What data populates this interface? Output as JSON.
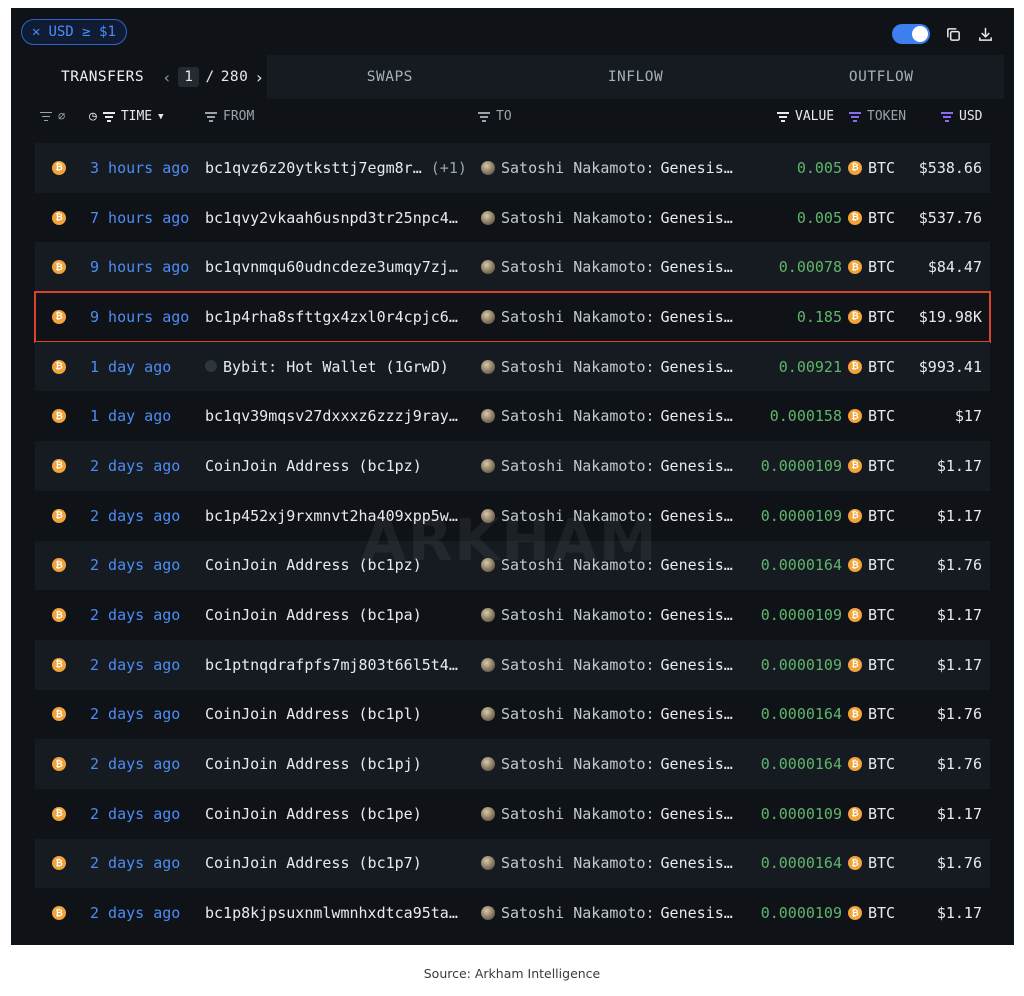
{
  "filter_chip": {
    "label": "USD ≥ $1"
  },
  "tabs": [
    {
      "label": "TRANSFERS"
    },
    {
      "label": "SWAPS"
    },
    {
      "label": "INFLOW"
    },
    {
      "label": "OUTFLOW"
    }
  ],
  "pagination": {
    "current": "1",
    "separator": "/",
    "total": "280"
  },
  "columns": {
    "time": "TIME",
    "from": "FROM",
    "to": "TO",
    "value": "VALUE",
    "token": "TOKEN",
    "usd": "USD"
  },
  "rows": [
    {
      "time": "3 hours ago",
      "from": "bc1qvz6z20ytksttj7egm8r…",
      "from_extra": "(+1)",
      "to_name": "Satoshi Nakamoto:",
      "to_detail": "Genesis…",
      "value": "0.005",
      "token": "BTC",
      "usd": "$538.66"
    },
    {
      "time": "7 hours ago",
      "from": "bc1qvy2vkaah6usnpd3tr25npc4…",
      "from_extra": "",
      "to_name": "Satoshi Nakamoto:",
      "to_detail": "Genesis…",
      "value": "0.005",
      "token": "BTC",
      "usd": "$537.76"
    },
    {
      "time": "9 hours ago",
      "from": "bc1qvnmqu60udncdeze3umqy7zj…",
      "from_extra": "",
      "to_name": "Satoshi Nakamoto:",
      "to_detail": "Genesis…",
      "value": "0.00078",
      "token": "BTC",
      "usd": "$84.47"
    },
    {
      "time": "9 hours ago",
      "from": "bc1p4rha8sfttgx4zxl0r4cpjc6…",
      "from_extra": "",
      "to_name": "Satoshi Nakamoto:",
      "to_detail": "Genesis…",
      "value": "0.185",
      "token": "BTC",
      "usd": "$19.98K"
    },
    {
      "time": "1 day ago",
      "from": "Bybit: Hot Wallet (1GrwD)",
      "from_extra": "",
      "to_name": "Satoshi Nakamoto:",
      "to_detail": "Genesis…",
      "value": "0.00921",
      "token": "BTC",
      "usd": "$993.41"
    },
    {
      "time": "1 day ago",
      "from": "bc1qv39mqsv27dxxxz6zzzj9ray…",
      "from_extra": "",
      "to_name": "Satoshi Nakamoto:",
      "to_detail": "Genesis…",
      "value": "0.000158",
      "token": "BTC",
      "usd": "$17"
    },
    {
      "time": "2 days ago",
      "from": "CoinJoin Address (bc1pz)",
      "from_extra": "",
      "to_name": "Satoshi Nakamoto:",
      "to_detail": "Genesis…",
      "value": "0.0000109",
      "token": "BTC",
      "usd": "$1.17"
    },
    {
      "time": "2 days ago",
      "from": "bc1p452xj9rxmnvt2ha409xpp5w…",
      "from_extra": "",
      "to_name": "Satoshi Nakamoto:",
      "to_detail": "Genesis…",
      "value": "0.0000109",
      "token": "BTC",
      "usd": "$1.17"
    },
    {
      "time": "2 days ago",
      "from": "CoinJoin Address (bc1pz)",
      "from_extra": "",
      "to_name": "Satoshi Nakamoto:",
      "to_detail": "Genesis…",
      "value": "0.0000164",
      "token": "BTC",
      "usd": "$1.76"
    },
    {
      "time": "2 days ago",
      "from": "CoinJoin Address (bc1pa)",
      "from_extra": "",
      "to_name": "Satoshi Nakamoto:",
      "to_detail": "Genesis…",
      "value": "0.0000109",
      "token": "BTC",
      "usd": "$1.17"
    },
    {
      "time": "2 days ago",
      "from": "bc1ptnqdrafpfs7mj803t66l5t4…",
      "from_extra": "",
      "to_name": "Satoshi Nakamoto:",
      "to_detail": "Genesis…",
      "value": "0.0000109",
      "token": "BTC",
      "usd": "$1.17"
    },
    {
      "time": "2 days ago",
      "from": "CoinJoin Address (bc1pl)",
      "from_extra": "",
      "to_name": "Satoshi Nakamoto:",
      "to_detail": "Genesis…",
      "value": "0.0000164",
      "token": "BTC",
      "usd": "$1.76"
    },
    {
      "time": "2 days ago",
      "from": "CoinJoin Address (bc1pj)",
      "from_extra": "",
      "to_name": "Satoshi Nakamoto:",
      "to_detail": "Genesis…",
      "value": "0.0000164",
      "token": "BTC",
      "usd": "$1.76"
    },
    {
      "time": "2 days ago",
      "from": "CoinJoin Address (bc1pe)",
      "from_extra": "",
      "to_name": "Satoshi Nakamoto:",
      "to_detail": "Genesis…",
      "value": "0.0000109",
      "token": "BTC",
      "usd": "$1.17"
    },
    {
      "time": "2 days ago",
      "from": "CoinJoin Address (bc1p7)",
      "from_extra": "",
      "to_name": "Satoshi Nakamoto:",
      "to_detail": "Genesis…",
      "value": "0.0000164",
      "token": "BTC",
      "usd": "$1.76"
    },
    {
      "time": "2 days ago",
      "from": "bc1p8kjpsuxnmlwmnhxdtca95ta…",
      "from_extra": "",
      "to_name": "Satoshi Nakamoto:",
      "to_detail": "Genesis…",
      "value": "0.0000109",
      "token": "BTC",
      "usd": "$1.17"
    }
  ],
  "highlighted_row_index": 3,
  "watermark": "ARKHAM",
  "caption": "Source: Arkham Intelligence",
  "colors": {
    "accent": "#4d8cf5",
    "value_green": "#5fb56b",
    "btc_orange": "#f2a33a",
    "highlight": "#d8432b"
  }
}
